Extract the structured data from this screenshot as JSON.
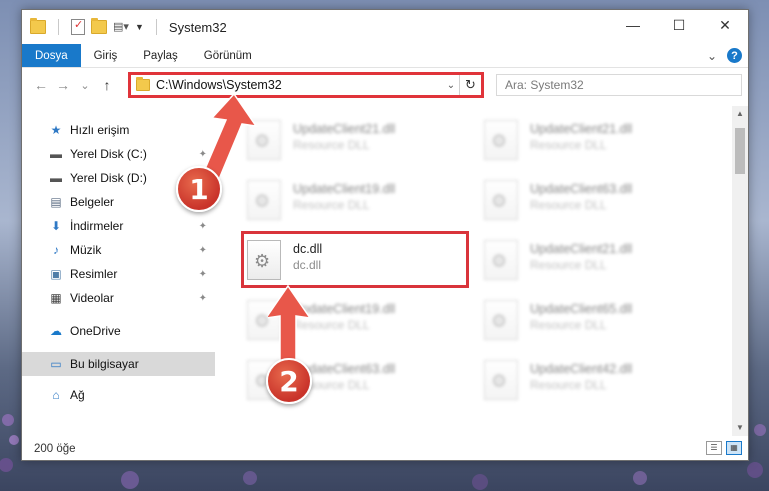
{
  "titlebar": {
    "title": "System32",
    "minimize": "—",
    "maximize": "☐",
    "close": "✕"
  },
  "ribbon": {
    "tabs": [
      {
        "label": "Dosya",
        "active": true
      },
      {
        "label": "Giriş"
      },
      {
        "label": "Paylaş"
      },
      {
        "label": "Görünüm"
      }
    ],
    "expand_glyph": "⌄",
    "help_glyph": "?"
  },
  "nav": {
    "back": "←",
    "forward": "→",
    "recent": "⌄",
    "up": "↑",
    "address": "C:\\Windows\\System32",
    "address_dropdown": "⌄",
    "refresh": "↻",
    "search_placeholder": "Ara: System32"
  },
  "sidebar": {
    "items": [
      {
        "label": "Hızlı erişim",
        "icon": "star-icon",
        "glyph": "★",
        "color": "#2f79c5"
      },
      {
        "label": "Yerel Disk (C:)",
        "icon": "drive-icon",
        "glyph": "▬",
        "color": "#555555",
        "pinned": true
      },
      {
        "label": "Yerel Disk (D:)",
        "icon": "drive-icon",
        "glyph": "▬",
        "color": "#555555",
        "pinned": true
      },
      {
        "label": "Belgeler",
        "icon": "documents-icon",
        "glyph": "▤",
        "color": "#5a6b82",
        "pinned": true
      },
      {
        "label": "İndirmeler",
        "icon": "download-icon",
        "glyph": "⬇",
        "color": "#2f79c5",
        "pinned": true
      },
      {
        "label": "Müzik",
        "icon": "music-icon",
        "glyph": "♪",
        "color": "#2f79c5",
        "pinned": true
      },
      {
        "label": "Resimler",
        "icon": "pictures-icon",
        "glyph": "▣",
        "color": "#4f7da8",
        "pinned": true
      },
      {
        "label": "Videolar",
        "icon": "video-icon",
        "glyph": "▦",
        "color": "#444444",
        "pinned": true
      },
      {
        "label": "OneDrive",
        "icon": "cloud-icon",
        "glyph": "☁",
        "color": "#1979ca"
      },
      {
        "label": "Bu bilgisayar",
        "icon": "computer-icon",
        "glyph": "▭",
        "color": "#2f79c5",
        "selected": true
      },
      {
        "label": "Ağ",
        "icon": "network-icon",
        "glyph": "⌂",
        "color": "#2f79c5"
      }
    ],
    "pin_glyph": "📌"
  },
  "files": [
    {
      "name": "UpdateClient21.dll",
      "sub": "Resource DLL",
      "blur": true
    },
    {
      "name": "UpdateClient21.dll",
      "sub": "Resource DLL",
      "blur": true
    },
    {
      "name": "UpdateClient19.dll",
      "sub": "Resource DLL",
      "blur": true
    },
    {
      "name": "UpdateClient63.dll",
      "sub": "Resource DLL",
      "blur": true
    },
    {
      "name": "dc.dll",
      "sub": "dc.dll",
      "blur": false
    },
    {
      "name": "UpdateClient21.dll",
      "sub": "Resource DLL",
      "blur": true
    },
    {
      "name": "UpdateClient19.dll",
      "sub": "Resource DLL",
      "blur": true
    },
    {
      "name": "UpdateClient65.dll",
      "sub": "Resource DLL",
      "blur": true
    },
    {
      "name": "UpdateClient63.dll",
      "sub": "Resource DLL",
      "blur": true
    },
    {
      "name": "UpdateClient42.dll",
      "sub": "Resource DLL",
      "blur": true
    }
  ],
  "status": {
    "count": "200 öğe"
  },
  "callouts": {
    "one": "1",
    "two": "2"
  },
  "colors": {
    "accent": "#1979ca",
    "highlight_red": "#d9343b"
  }
}
